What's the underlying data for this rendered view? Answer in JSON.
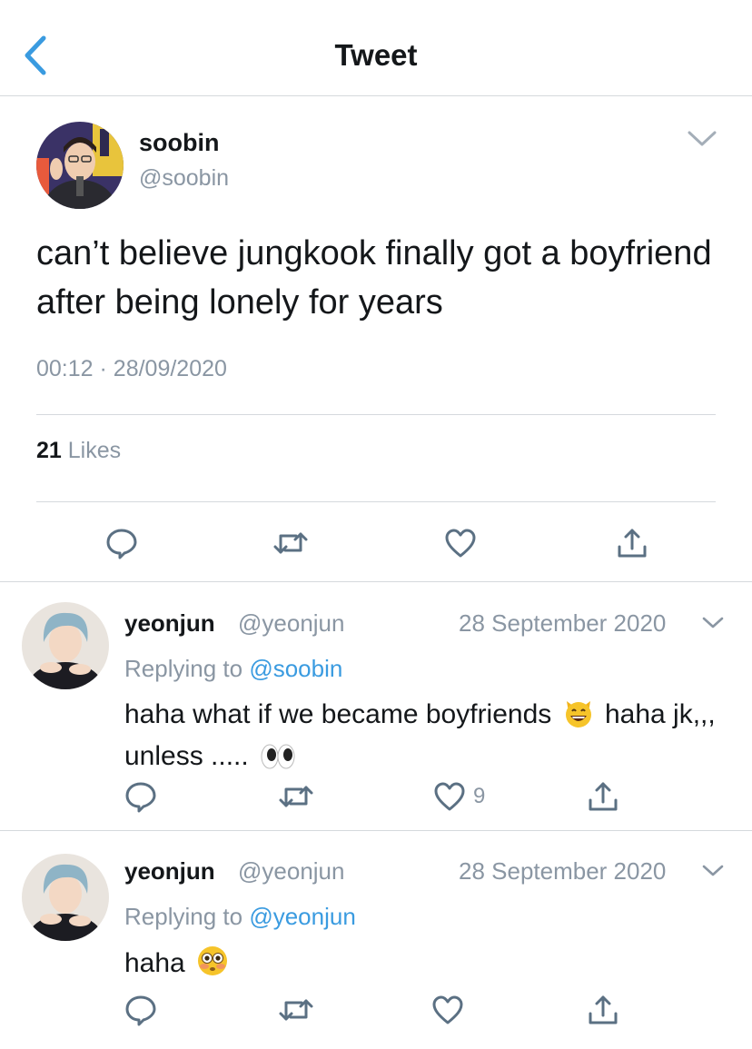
{
  "header": {
    "title": "Tweet",
    "back_icon": "chevron-left-icon"
  },
  "main_tweet": {
    "name": "soobin",
    "handle": "@soobin",
    "text": "can’t believe jungkook finally got a boyfriend after being lonely for years",
    "time": "00:12",
    "separator": "·",
    "date": "28/09/2020",
    "likes_count": "21",
    "likes_label": "Likes"
  },
  "replies": [
    {
      "name": "yeonjun",
      "handle": "@yeonjun",
      "date": "28 September 2020",
      "replying_prefix": "Replying to",
      "replying_to": "@soobin",
      "text_part1": "haha what if we became boyfriends",
      "emoji1": "grinning-cat-emoji",
      "text_part2": "haha jk,,, unless .....",
      "emoji2": "eyes-emoji",
      "like_count": "9"
    },
    {
      "name": "yeonjun",
      "handle": "@yeonjun",
      "date": "28 September 2020",
      "replying_prefix": "Replying to",
      "replying_to": "@yeonjun",
      "text_part1": "haha",
      "emoji1": "flushed-face-emoji"
    }
  ],
  "colors": {
    "accent": "#3a9be0",
    "text": "#14171a",
    "muted": "#8a96a3",
    "icon": "#5b7083",
    "divider": "#d5d9dd"
  }
}
